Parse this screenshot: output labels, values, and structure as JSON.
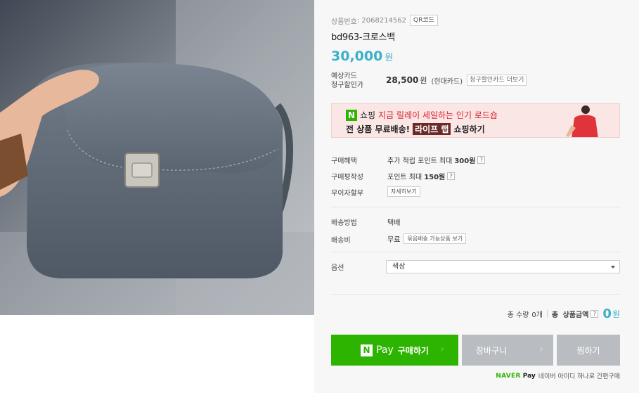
{
  "product": {
    "number_label": "상품번호",
    "number_value": "2068214562",
    "qr_button": "QR코드",
    "title": "bd963-크로스백",
    "price_value": "30,000",
    "price_unit": "원"
  },
  "card_discount": {
    "label_line1": "예상카드",
    "label_line2": "청구할인가",
    "price": "28,500",
    "unit": "원",
    "card_name": "(현대카드)",
    "more_button": "청구할인카드 더보기"
  },
  "banner": {
    "n_logo": "N",
    "line1_prefix": "쇼핑",
    "line1_highlight": "지금 릴레이 세일하는 인기 로드숍",
    "line2_prefix": "전 상품 무료배송!",
    "line2_tag": "라이프 랩",
    "line2_suffix": "쇼핑하기"
  },
  "benefits": {
    "purchase_benefit_label": "구매혜택",
    "purchase_benefit_text": "추가 적립 포인트 최대",
    "purchase_benefit_amount": "300원",
    "review_label": "구매평작성",
    "review_text": "포인트 최대",
    "review_amount": "150원",
    "installment_label": "무이자할부",
    "installment_button": "자세히보기",
    "help_glyph": "?"
  },
  "shipping": {
    "method_label": "배송방법",
    "method_value": "택배",
    "fee_label": "배송비",
    "fee_value": "무료",
    "bundle_button": "묶음배송 가능상품 보기"
  },
  "option": {
    "label": "옵션",
    "selected": "색상"
  },
  "summary": {
    "qty_label": "총 수량",
    "qty_value": "0개",
    "total_prefix": "총",
    "total_label": "상품금액",
    "total_amount": "0",
    "total_unit": "원"
  },
  "actions": {
    "npay_logo": "N",
    "npay_pay": "Pay",
    "npay_buy": "구매하기",
    "cart": "장바구니",
    "wish": "찜하기",
    "chevron": "›"
  },
  "npay_note": {
    "naver": "NAVER",
    "pay": "Pay",
    "text": "네이버 아이디 하나로 간편구매"
  },
  "colors": {
    "accent": "#3bb0c9",
    "naver_green": "#2db400",
    "banner_bg": "#fbe6e6",
    "disabled_button": "#b9bdc2"
  }
}
